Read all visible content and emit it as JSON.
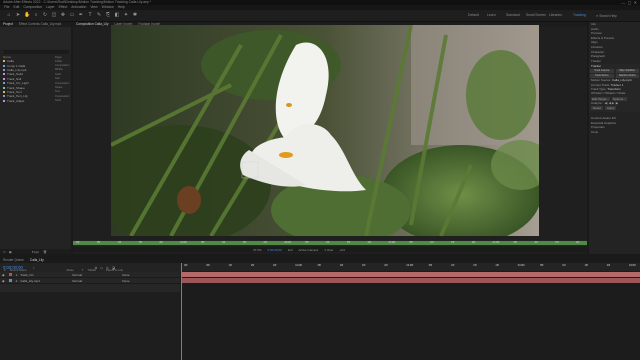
{
  "app": {
    "title": "Adobe After Effects 2022 - C:\\Users\\Rudi\\Desktop\\Motion Tracking\\Motion Tracking Calla Lily.aep *",
    "menu": [
      "File",
      "Edit",
      "Composition",
      "Layer",
      "Effect",
      "Animation",
      "View",
      "Window",
      "Help"
    ],
    "workspaces": [
      "Default",
      "Learn",
      "Standard",
      "Small Screen",
      "Libraries",
      "Tracking"
    ],
    "active_workspace": "Tracking",
    "search_placeholder": "Search Help"
  },
  "project": {
    "tabs": [
      "Project",
      "Effect Controls Calla_Lily.mp4"
    ],
    "search_placeholder": "",
    "columns": {
      "name": "Name",
      "type": "Type"
    },
    "items": [
      {
        "name": "Calla",
        "type": "Folder",
        "color": "#d6b94a"
      },
      {
        "name": "Comp 1 Calla",
        "type": "Composition",
        "color": "#7aa0c9"
      },
      {
        "name": "Calla_Lily.mp4",
        "type": "MPEG",
        "color": "#7aa0c9"
      },
      {
        "name": "Track_Solid",
        "type": "Solid",
        "color": "#c98fd6"
      },
      {
        "name": "Track_Null",
        "type": "Null",
        "color": "#c98fd6"
      },
      {
        "name": "Track_CC_Light",
        "type": "Composition",
        "color": "#7aa0c9"
      },
      {
        "name": "Track_Shape",
        "type": "Shape",
        "color": "#6fc7a6"
      },
      {
        "name": "Track_Text",
        "type": "Text",
        "color": "#d6b94a"
      },
      {
        "name": "Track_Text_Lily",
        "type": "Composition",
        "color": "#7aa0c9"
      },
      {
        "name": "Track_Adjust",
        "type": "Solid",
        "color": "#c98fd6"
      }
    ],
    "footer": "8 bpc"
  },
  "composition": {
    "tabs": [
      "Composition Calla_Lily",
      "Layer (none)",
      "Footage (none)"
    ],
    "breadcrumb": "Calla_Lily",
    "ruler_ticks": [
      "00f",
      "05f",
      "10f",
      "15f",
      "20f",
      "01:00f",
      "05f",
      "10f",
      "15f",
      "20f",
      "02:00f",
      "05f",
      "10f",
      "15f",
      "20f",
      "03:00f",
      "05f",
      "10f",
      "15f",
      "20f",
      "04:00f",
      "05f",
      "10f",
      "15f",
      "20f"
    ],
    "footer": {
      "zoom": "37.5%",
      "timecode": "0;00;00;00",
      "resolution": "Full",
      "camera": "Active Camera",
      "views": "1 View",
      "exposure": "+0.0"
    },
    "colors": {
      "ruler_band": "#4f8a47",
      "marker_green": "#5aa04f"
    }
  },
  "right_panel": {
    "tabs": [
      "Info",
      "Audio",
      "Preview",
      "Effects & Presets",
      "Align",
      "Libraries",
      "Character",
      "Paragraph",
      "Tracker"
    ],
    "tracker": {
      "title": "Tracker",
      "buttons": [
        "Track Camera",
        "Warp Stabilizer",
        "Track Motion",
        "Stabilize Motion"
      ],
      "motion_source_label": "Motion Source:",
      "motion_source": "Calla_Lily.mp4",
      "current_track_label": "Current Track:",
      "current_track": "Tracker 1",
      "track_type_label": "Track Type:",
      "track_type": "Transform",
      "options": [
        "Position",
        "Rotation",
        "Scale"
      ],
      "edit_target": "Edit Target...",
      "options_button": "Options...",
      "analyze_label": "Analyze:",
      "reset": "Reset",
      "apply": "Apply"
    },
    "more": [
      "Content-Aware Fill",
      "Essential Graphics",
      "Properties",
      "Tools"
    ]
  },
  "timeline": {
    "tabs": [
      "Render Queue",
      "Calla_Lily"
    ],
    "timecode": "0;00;00;00",
    "columns": [
      "#",
      "Source Name",
      "Mode",
      "T",
      "TrkMat",
      "Parent & Link"
    ],
    "layers": [
      {
        "num": "1",
        "name": "Track_CC",
        "mode": "Normal",
        "parent": "None",
        "color": "#c94a4a"
      },
      {
        "num": "2",
        "name": "Calla_Lily.mp4",
        "mode": "Normal",
        "parent": "None",
        "color": "#5b8fc9"
      }
    ],
    "ruler_ticks": [
      "00f",
      "05f",
      "10f",
      "15f",
      "20f",
      "01:00f",
      "05f",
      "10f",
      "15f",
      "20f",
      "02:00f",
      "05f",
      "10f",
      "15f",
      "20f",
      "03:00f",
      "05f",
      "10f",
      "15f",
      "20f",
      "04:00f"
    ],
    "bar_colors": [
      "#b46a6a",
      "#9b5757"
    ]
  }
}
